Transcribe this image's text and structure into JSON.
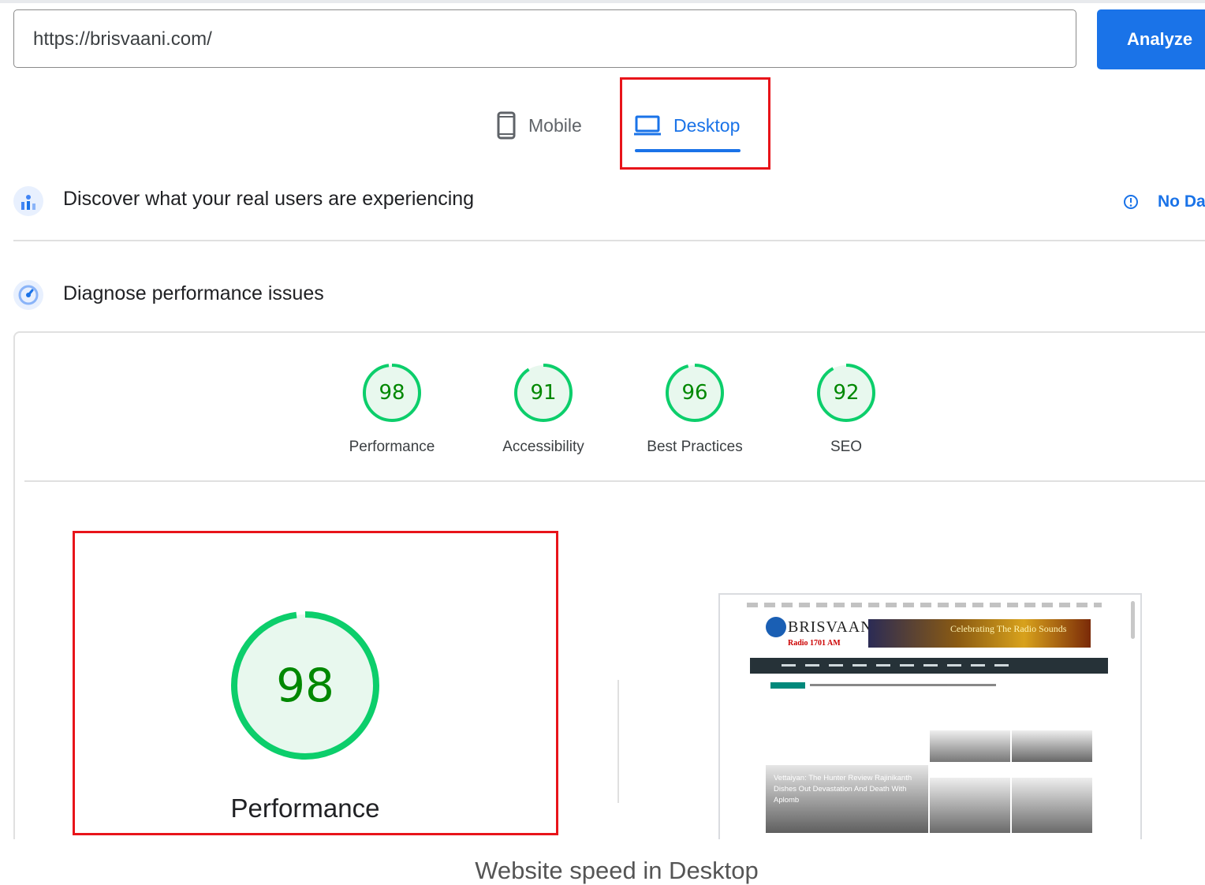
{
  "url_bar": {
    "value": "https://brisvaani.com/",
    "analyze_label": "Analyze"
  },
  "tabs": [
    {
      "label": "Mobile",
      "icon": "smartphone-icon",
      "selected": false
    },
    {
      "label": "Desktop",
      "icon": "laptop-icon",
      "selected": true
    }
  ],
  "field_data": {
    "title": "Discover what your real users are experiencing",
    "status_label": "No Da",
    "icon": "users-chart-icon"
  },
  "diagnose": {
    "title": "Diagnose performance issues",
    "icon": "gauge-icon"
  },
  "scores": [
    {
      "value": "98",
      "label": "Performance",
      "fraction": 0.98
    },
    {
      "value": "91",
      "label": "Accessibility",
      "fraction": 0.91
    },
    {
      "value": "96",
      "label": "Best Practices",
      "fraction": 0.96
    },
    {
      "value": "92",
      "label": "SEO",
      "fraction": 0.92
    }
  ],
  "main_score": {
    "value": "98",
    "label": "Performance",
    "fraction": 0.98
  },
  "thumbnail": {
    "logo_text": "BRISVAANI",
    "logo_subtext": "Radio 1701 AM",
    "banner_text": "Celebrating The Radio Sounds",
    "headline": "Vettaiyan: The Hunter Review Rajinikanth Dishes Out Devastation And Death With Aplomb"
  },
  "caption": "Website speed in Desktop",
  "colors": {
    "accent": "#1a73e8",
    "pass": "#0cce6b",
    "pass_text": "#008800",
    "highlight": "#e8141a"
  }
}
